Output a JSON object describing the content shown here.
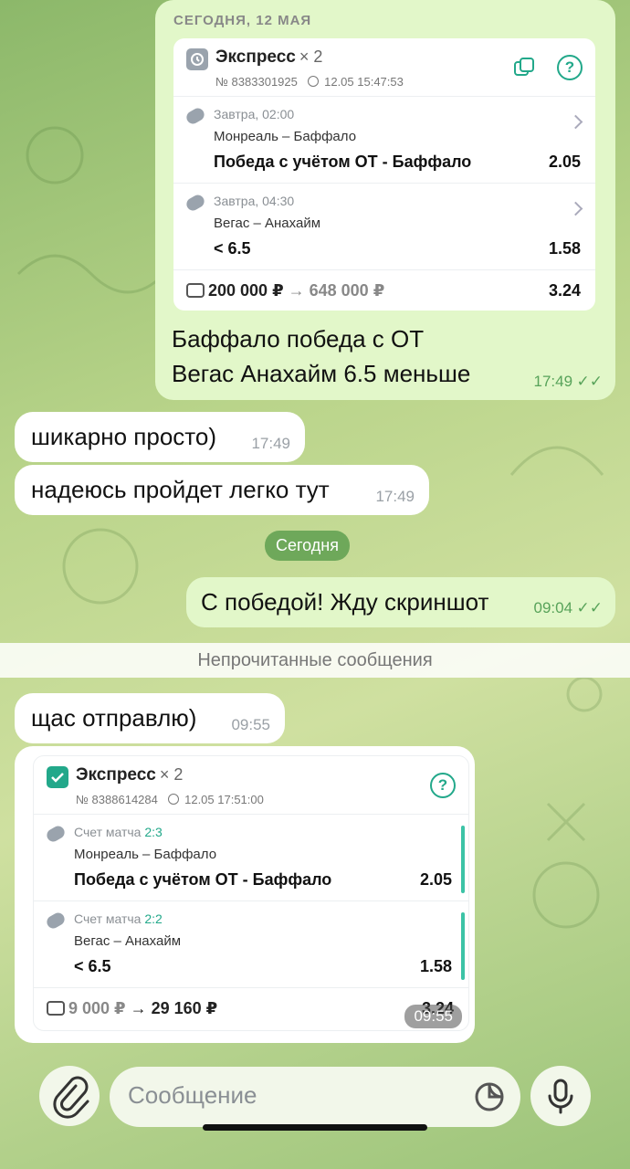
{
  "day_header_1": "СЕГОДНЯ, 12 МАЯ",
  "ticket1": {
    "title": "Экспресс",
    "multiplier": "× 2",
    "number": "№ 8383301925",
    "datetime": "12.05 15:47:53",
    "legs": [
      {
        "status": "Завтра, 02:00",
        "teams": "Монреаль – Баффало",
        "market": "Победа с учётом ОТ - Баффало",
        "odds": "2.05"
      },
      {
        "status": "Завтра, 04:30",
        "teams": "Вегас – Анахайм",
        "market": "< 6.5",
        "odds": "1.58"
      }
    ],
    "stake": "200 000 ₽",
    "win": "648 000 ₽",
    "total_odds": "3.24"
  },
  "msg_out_1": {
    "line1": "Баффало победа с ОТ",
    "line2": "Вегас Анахайм 6.5 меньше",
    "time": "17:49"
  },
  "msg_in_1": {
    "text": "шикарно просто)",
    "time": "17:49"
  },
  "msg_in_2": {
    "text": "надеюсь пройдет легко тут",
    "time": "17:49"
  },
  "date_pill": "Сегодня",
  "msg_out_2": {
    "text": "С победой! Жду скриншот",
    "time": "09:04"
  },
  "unread_label": "Непрочитанные сообщения",
  "msg_in_3": {
    "text": "щас отправлю)",
    "time": "09:55"
  },
  "ticket2": {
    "title": "Экспресс",
    "multiplier": "× 2",
    "number": "№ 8388614284",
    "datetime": "12.05 17:51:00",
    "legs": [
      {
        "status_label": "Счет матча",
        "score": "2:3",
        "teams": "Монреаль – Баффало",
        "market": "Победа с учётом ОТ - Баффало",
        "odds": "2.05"
      },
      {
        "status_label": "Счет матча",
        "score": "2:2",
        "teams": "Вегас – Анахайм",
        "market": "< 6.5",
        "odds": "1.58"
      }
    ],
    "stake": "9 000 ₽",
    "win": "29 160 ₽",
    "total_odds": "3.24",
    "time": "09:55"
  },
  "input": {
    "placeholder": "Сообщение"
  },
  "colors": {
    "outgoing_bubble": "#e2f7c9",
    "accent_green": "#58a35a",
    "win_bar": "#3cc3a6"
  }
}
